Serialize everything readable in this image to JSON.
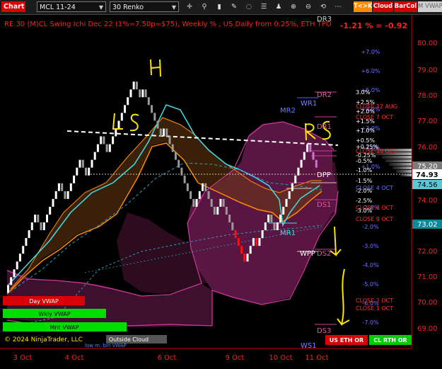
{
  "toolbar": {
    "tab_label": "Chart",
    "instrument": "MCL 11-24",
    "bar_type": "30 Renko",
    "icons": [
      "crosshair-icon",
      "magnifier-icon",
      "bar-style-icon",
      "drawing-tools-icon",
      "hide-drawings-icon",
      "properties-icon",
      "strategy-icon",
      "zoom-in-icon",
      "zoom-out-icon",
      "unknown-icon",
      "replay-icon",
      "more-icon"
    ],
    "btn_tk": "T<>K",
    "btn_cloud": "Cloud",
    "btn_barcol": "BarCol",
    "btn_vwap": "M VWAP",
    "colors": {
      "tk": "#ff8c00",
      "cloud": "#d00000",
      "barcol": "#d00000",
      "vwap": "#cfcfcf"
    }
  },
  "header": {
    "title": "RE 30 (M)CL Swing Ichi Dec 22  (1%=7.50p=$75), Weekly % , US Daily from 0.25%, ETH TPO",
    "change": "-1.21 % = -0.92"
  },
  "price_axis": {
    "ticks": [
      "80.00",
      "79.00",
      "78.00",
      "77.00",
      "76.00",
      "75.20",
      "74.56",
      "74.00",
      "73.02",
      "72.00",
      "71.00",
      "70.00",
      "69.00"
    ],
    "last_price": "74.93",
    "badges": {
      "gray": "75.20",
      "cyan": "74.56",
      "teal": "73.02",
      "white": "74.93"
    }
  },
  "time_axis": {
    "labels": [
      "3 Oct",
      "4 Oct",
      "6 Oct",
      "9 Oct",
      "10 Oct",
      "11 Oct"
    ]
  },
  "percent_labels": {
    "weekly": [
      "+7.0%",
      "+6.0%",
      "+5.0%",
      "+4.0%",
      "+3.0%",
      "+2.0%",
      "+1.0%",
      "-1.0%",
      "-2.0%",
      "-3.0%",
      "-4.0%",
      "-5.0%",
      "-6.0%",
      "-7.0%"
    ],
    "daily": [
      "3.0%",
      "+2.5%",
      "+2.0%",
      "+1.5%",
      "+1.0%",
      "+0.5%",
      "+0.25%",
      "-0.25%",
      "-0.5%",
      "-1.0%",
      "-1.5%",
      "-2.0%",
      "-2.5%",
      "-3.0%"
    ]
  },
  "pivot_labels": {
    "dr3": "DR3",
    "dr2": "DR2",
    "dr1": "DR1",
    "dpp": "DPP",
    "ds1": "DS1",
    "ds2": "DS2",
    "ds3": "DS3",
    "wr1": "WR1",
    "mr2": "MR2",
    "mr1": "MR1",
    "wpp": "WPP",
    "ws1": "WS1"
  },
  "close_labels": [
    "CLOSE 12 AUG",
    "CLOSE 7 OCT",
    "CLOSE 10 OCT",
    "CLOSE 4 OCT",
    "CLOSE 8 OCT",
    "CLOSE 9 OCT",
    "CLOSE 2 OCT",
    "CLOSE 1 OCT"
  ],
  "vwap_labels": {
    "day": "Day VWAP",
    "wkly": "Wkly VWAP",
    "mnt": "Mnt VWAP",
    "outside_cloud": "Outside Cloud",
    "low_hint": "low m. bin VWAP"
  },
  "bottom_buttons": {
    "eth": "US ETH OR",
    "rth": "CL RTH OR"
  },
  "copyright": "© 2024 NinjaTrader, LLC",
  "annotations": {
    "H": "H",
    "LS": "LS",
    "RS": "RS"
  },
  "chart_data": {
    "type": "renko",
    "brick_size": 0.3,
    "ylim": [
      68.5,
      80.5
    ],
    "close_sequence": [
      70.7,
      71.0,
      71.3,
      71.6,
      71.9,
      72.2,
      72.5,
      72.8,
      73.1,
      73.4,
      73.1,
      72.8,
      73.1,
      73.4,
      73.7,
      74.0,
      74.3,
      74.6,
      74.3,
      74.0,
      74.3,
      74.6,
      74.9,
      75.2,
      75.5,
      75.2,
      74.9,
      75.2,
      75.5,
      75.8,
      76.1,
      76.4,
      76.1,
      75.8,
      76.1,
      76.4,
      76.7,
      77.0,
      77.3,
      77.6,
      77.9,
      78.2,
      78.5,
      78.2,
      77.9,
      78.2,
      77.9,
      77.6,
      77.3,
      77.0,
      76.7,
      76.4,
      76.7,
      76.4,
      76.1,
      75.8,
      75.5,
      75.2,
      74.9,
      74.6,
      74.3,
      74.0,
      73.7,
      74.0,
      74.3,
      74.6,
      74.3,
      74.0,
      73.7,
      73.4,
      73.7,
      74.0,
      73.7,
      73.4,
      73.1,
      72.8,
      72.5,
      72.2,
      71.9,
      71.6,
      71.9,
      72.2,
      72.5,
      72.2,
      72.5,
      72.8,
      73.1,
      73.4,
      73.1,
      72.8,
      73.1,
      73.4,
      73.7,
      74.0,
      74.3,
      74.6,
      74.9,
      75.2,
      75.5,
      75.8,
      76.1,
      75.8,
      75.5,
      75.2
    ],
    "pivots": {
      "DR3": 80.3,
      "DR2": 78.0,
      "DR1": 76.7,
      "DPP": 74.93,
      "DS1": 74.2,
      "DS2": 71.95,
      "DS3": 68.95,
      "WR1": 77.7,
      "MR2": 77.55,
      "MR1": 73.1,
      "WPP": 72.0,
      "WS1": 68.4
    },
    "cursor_line": 74.93,
    "neckline": [
      [
        3.2,
        76.8
      ],
      [
        11.3,
        75.9
      ]
    ],
    "grid": false
  }
}
